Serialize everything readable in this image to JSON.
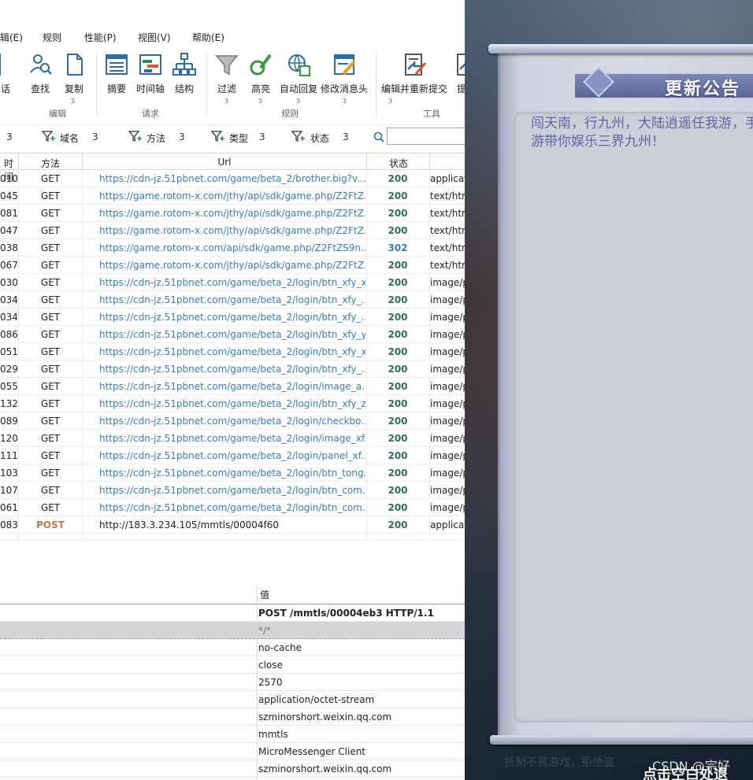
{
  "menu": [
    "辑(E)",
    "规则",
    "性能(P)",
    "视图(V)",
    "帮助(E)"
  ],
  "ribbon": {
    "buttons": [
      {
        "label": "话",
        "icon": "document-icon"
      },
      {
        "label": "查找",
        "icon": "search-person-icon"
      },
      {
        "label": "复制",
        "icon": "copy-icon"
      },
      {
        "label": "摘要",
        "icon": "summary-icon"
      },
      {
        "label": "时间轴",
        "icon": "timeline-icon"
      },
      {
        "label": "结构",
        "icon": "structure-icon"
      },
      {
        "label": "过滤",
        "icon": "filter-icon"
      },
      {
        "label": "高亮",
        "icon": "highlight-icon"
      },
      {
        "label": "自动回复",
        "icon": "auto-reply-icon"
      },
      {
        "label": "修改消息头",
        "icon": "edit-header-icon"
      },
      {
        "label": "编辑并重新提交",
        "icon": "edit-resubmit-icon"
      },
      {
        "label": "提交",
        "icon": "submit-icon"
      }
    ],
    "badges": [
      "3",
      "3",
      "3",
      "3",
      "3",
      "3"
    ],
    "groups": [
      "编辑",
      "请求",
      "规则",
      "工具"
    ]
  },
  "filters": [
    {
      "label": "",
      "count": "3"
    },
    {
      "label": "域名",
      "count": "3"
    },
    {
      "label": "方法",
      "count": "3"
    },
    {
      "label": "类型",
      "count": "3"
    },
    {
      "label": "状态",
      "count": "3"
    }
  ],
  "grid": {
    "headers": [
      "时间",
      "方法",
      "Url",
      "状态"
    ],
    "rows": [
      {
        "time": "010",
        "method": "GET",
        "url": "https://cdn-jz.51pbnet.com/game/beta_2/brother.big?v...",
        "status": "200",
        "type": "applicat"
      },
      {
        "time": "045",
        "method": "GET",
        "url": "https://game.rotom-x.com/jthy/api/sdk/game.php/Z2FtZ...",
        "status": "200",
        "type": "text/htm"
      },
      {
        "time": "081",
        "method": "GET",
        "url": "https://game.rotom-x.com/jthy/api/sdk/game.php/Z2FtZ...",
        "status": "200",
        "type": "text/htm"
      },
      {
        "time": "047",
        "method": "GET",
        "url": "https://game.rotom-x.com/jthy/api/sdk/game.php/Z2FtZ...",
        "status": "200",
        "type": "text/htm"
      },
      {
        "time": "038",
        "method": "GET",
        "url": "https://game.rotom-x.com/api/sdk/game.php/Z2FtZS9n...",
        "status": "302",
        "type": "text/htm"
      },
      {
        "time": "067",
        "method": "GET",
        "url": "https://game.rotom-x.com/jthy/api/sdk/game.php/Z2FtZ...",
        "status": "200",
        "type": "text/htm"
      },
      {
        "time": "030",
        "method": "GET",
        "url": "https://cdn-jz.51pbnet.com/game/beta_2/login/btn_xfy_x...",
        "status": "200",
        "type": "image/p"
      },
      {
        "time": "034",
        "method": "GET",
        "url": "https://cdn-jz.51pbnet.com/game/beta_2/login/btn_xfy_...",
        "status": "200",
        "type": "image/p"
      },
      {
        "time": "034",
        "method": "GET",
        "url": "https://cdn-jz.51pbnet.com/game/beta_2/login/btn_xfy_...",
        "status": "200",
        "type": "image/p"
      },
      {
        "time": "086",
        "method": "GET",
        "url": "https://cdn-jz.51pbnet.com/game/beta_2/login/btn_xfy_y...",
        "status": "200",
        "type": "image/p"
      },
      {
        "time": "051",
        "method": "GET",
        "url": "https://cdn-jz.51pbnet.com/game/beta_2/login/btn_xfy_x...",
        "status": "200",
        "type": "image/p"
      },
      {
        "time": "029",
        "method": "GET",
        "url": "https://cdn-jz.51pbnet.com/game/beta_2/login/btn_xfy_...",
        "status": "200",
        "type": "image/p"
      },
      {
        "time": "055",
        "method": "GET",
        "url": "https://cdn-jz.51pbnet.com/game/beta_2/login/image_a...",
        "status": "200",
        "type": "image/p"
      },
      {
        "time": "132",
        "method": "GET",
        "url": "https://cdn-jz.51pbnet.com/game/beta_2/login/btn_xfy_z...",
        "status": "200",
        "type": "image/p"
      },
      {
        "time": "089",
        "method": "GET",
        "url": "https://cdn-jz.51pbnet.com/game/beta_2/login/checkbo...",
        "status": "200",
        "type": "image/p"
      },
      {
        "time": "120",
        "method": "GET",
        "url": "https://cdn-jz.51pbnet.com/game/beta_2/login/image_xf...",
        "status": "200",
        "type": "image/p"
      },
      {
        "time": "111",
        "method": "GET",
        "url": "https://cdn-jz.51pbnet.com/game/beta_2/login/panel_xf...",
        "status": "200",
        "type": "image/p"
      },
      {
        "time": "103",
        "method": "GET",
        "url": "https://cdn-jz.51pbnet.com/game/beta_2/login/btn_tong...",
        "status": "200",
        "type": "image/p"
      },
      {
        "time": "107",
        "method": "GET",
        "url": "https://cdn-jz.51pbnet.com/game/beta_2/login/btn_com...",
        "status": "200",
        "type": "image/p"
      },
      {
        "time": "061",
        "method": "GET",
        "url": "https://cdn-jz.51pbnet.com/game/beta_2/login/btn_com...",
        "status": "200",
        "type": "image/p"
      },
      {
        "time": "083",
        "method": "POST",
        "url": "http://183.3.234.105/mmtls/00004f60",
        "status": "200",
        "type": "applicat"
      }
    ]
  },
  "detail": {
    "value_header": "值",
    "values": [
      "POST /mmtls/00004eb3 HTTP/1.1",
      "*/*",
      "no-cache",
      "close",
      "2570",
      "application/octet-stream",
      "szminorshort.weixin.qq.com",
      "mmtls",
      "MicroMessenger Client",
      "szminorshort.weixin.qq.com"
    ]
  },
  "game": {
    "title": "更新公告",
    "notice": "闯天南，行九州，大陆逍遥任我游，手游带你娱乐三界九州！",
    "footer_tip": "抵制不良游戏，拒绝盗",
    "click_hint": "点击空白处退",
    "watermark": "CSDN @宗好"
  },
  "colors": {
    "url_link": "#3a7bbd",
    "status_ok": "#2f6e5c",
    "post_method": "#c0784a",
    "scroll_title": "#5a6497"
  }
}
